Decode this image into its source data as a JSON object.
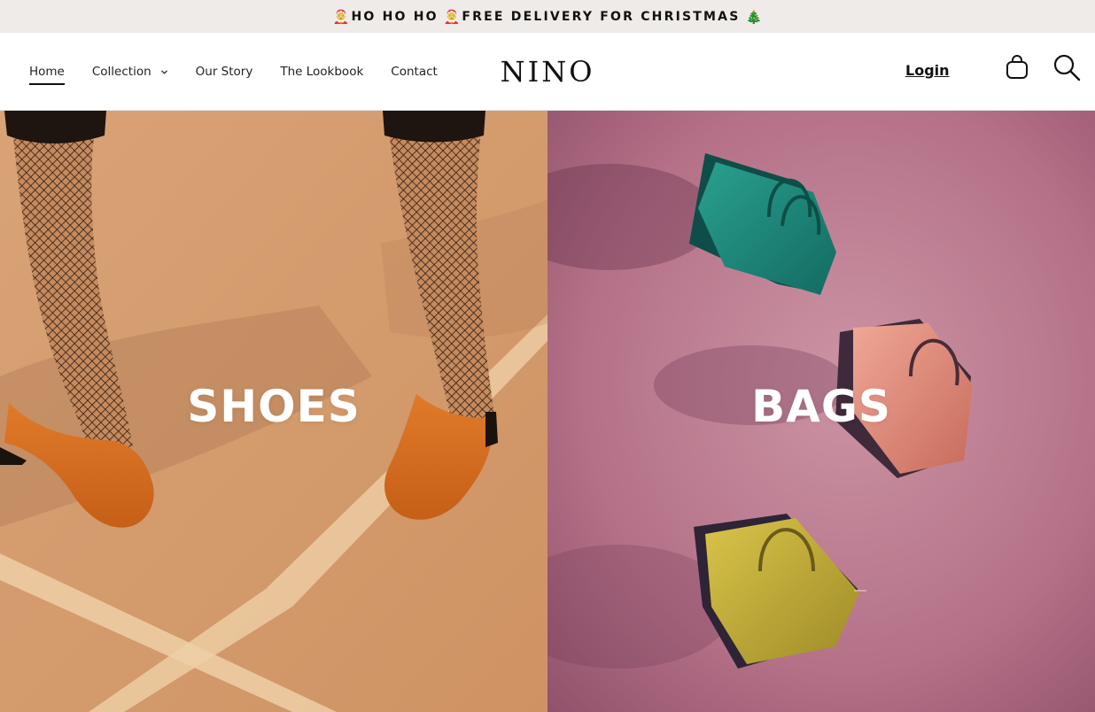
{
  "announcement": {
    "emoji_left": "🤶",
    "text_left": "HO HO HO",
    "emoji_mid": "🤶",
    "text_main": "FREE DELIVERY FOR CHRISTMAS",
    "emoji_right": "🎄"
  },
  "nav": {
    "items": [
      {
        "label": "Home",
        "active": true
      },
      {
        "label": "Collection",
        "has_dropdown": true
      },
      {
        "label": "Our Story"
      },
      {
        "label": "The Lookbook"
      },
      {
        "label": "Contact"
      }
    ]
  },
  "brand": {
    "logo": "NINO"
  },
  "account": {
    "login_label": "Login"
  },
  "icons": {
    "cart": "shopping-bag-icon",
    "search": "search-icon",
    "dropdown": "chevron-down-icon"
  },
  "hero": {
    "panels": [
      {
        "label": "SHOES",
        "background": "#d9a173"
      },
      {
        "label": "BAGS",
        "background": "#b5768d"
      }
    ]
  },
  "colors": {
    "announcement_bg": "#eeebe8",
    "text": "#111111",
    "shoes_bg": "#d9a173",
    "bags_bg": "#b5768d",
    "shoe_orange": "#d66f24",
    "bag_teal": "#1f8a7f",
    "bag_pink": "#e39482",
    "bag_yellow": "#c6b23a"
  }
}
